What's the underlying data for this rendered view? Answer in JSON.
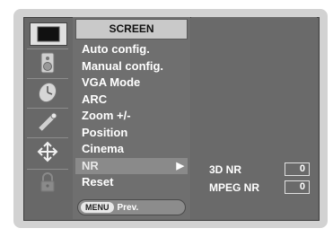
{
  "menu": {
    "title": "SCREEN",
    "items": [
      {
        "label": "Auto config."
      },
      {
        "label": "Manual config."
      },
      {
        "label": "VGA Mode"
      },
      {
        "label": "ARC"
      },
      {
        "label": "Zoom +/-"
      },
      {
        "label": "Position"
      },
      {
        "label": "Cinema"
      },
      {
        "label": "NR",
        "selected": true,
        "arrow": "▶"
      },
      {
        "label": "Reset"
      }
    ],
    "footer": {
      "key": "MENU",
      "action": "Prev."
    }
  },
  "submenu": {
    "rows": [
      {
        "label": "3D NR",
        "value": "0"
      },
      {
        "label": "MPEG NR",
        "value": "0"
      }
    ]
  },
  "icons": [
    "picture-icon",
    "sound-icon",
    "time-icon",
    "option-icon",
    "screen-icon",
    "lock-icon"
  ],
  "colors": {
    "osd_bg": "#686868",
    "title_bg": "#c9c9c9",
    "highlight": "#8a8a8a"
  }
}
